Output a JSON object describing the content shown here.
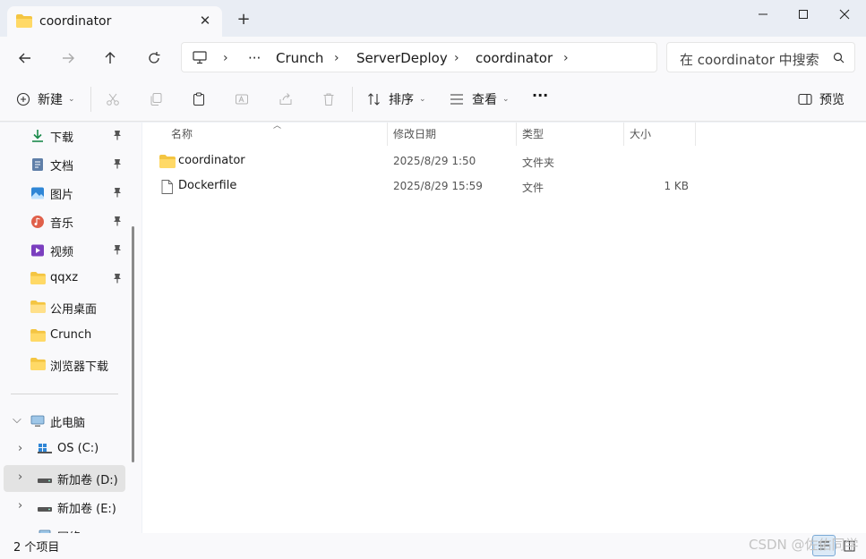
{
  "window": {
    "tab_title": "coordinator",
    "new_tab": "+",
    "close_tab": "✕"
  },
  "address": {
    "ellipsis": "···",
    "parts": [
      "Crunch",
      "ServerDeploy",
      "coordinator"
    ]
  },
  "search": {
    "placeholder": "在 coordinator 中搜索"
  },
  "toolbar": {
    "new_label": "新建",
    "sort_label": "排序",
    "view_label": "查看",
    "more_label": "···",
    "preview_label": "预览"
  },
  "sidebar": {
    "quick_access": [
      {
        "label": "下载",
        "icon": "download-icon",
        "pinned": true
      },
      {
        "label": "文档",
        "icon": "document-icon",
        "pinned": true
      },
      {
        "label": "图片",
        "icon": "picture-icon",
        "pinned": true
      },
      {
        "label": "音乐",
        "icon": "music-icon",
        "pinned": true
      },
      {
        "label": "视频",
        "icon": "video-icon",
        "pinned": true
      },
      {
        "label": "qqxz",
        "icon": "folder-icon",
        "pinned": true
      },
      {
        "label": "公用桌面",
        "icon": "folder-icon",
        "pinned": false
      },
      {
        "label": "Crunch",
        "icon": "folder-icon",
        "pinned": false
      },
      {
        "label": "浏览器下载",
        "icon": "folder-icon",
        "pinned": false
      }
    ],
    "this_pc": {
      "label": "此电脑",
      "icon": "computer-icon"
    },
    "drives": [
      {
        "label": "OS (C:)",
        "icon": "windows-drive-icon",
        "selected": false
      },
      {
        "label": "新加卷 (D:)",
        "icon": "drive-icon",
        "selected": true
      },
      {
        "label": "新加卷 (E:)",
        "icon": "drive-icon",
        "selected": false
      }
    ],
    "partial_next": "网络"
  },
  "columns": {
    "name": "名称",
    "date": "修改日期",
    "type": "类型",
    "size": "大小"
  },
  "files": [
    {
      "name": "coordinator",
      "date": "2025/8/29 1:50",
      "type": "文件夹",
      "size": "",
      "icon": "folder-icon"
    },
    {
      "name": "Dockerfile",
      "date": "2025/8/29 15:59",
      "type": "文件",
      "size": "1 KB",
      "icon": "file-icon"
    }
  ],
  "status": {
    "count": "2 个项目"
  },
  "watermark": "CSDN @佐佑同学",
  "colors": {
    "folder": "#f4c542",
    "accent": "#0067c0",
    "selected_bg": "#e3e3e3"
  }
}
